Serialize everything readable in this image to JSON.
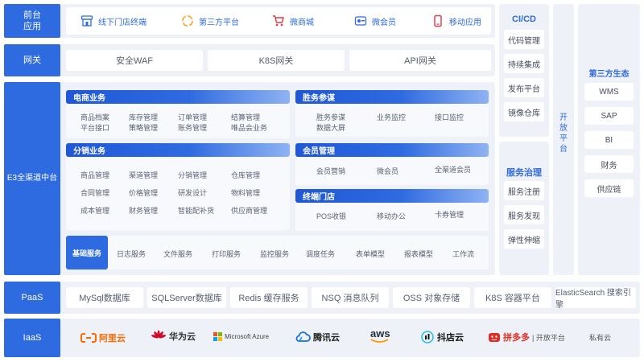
{
  "frontend": {
    "label": "前台\n应用",
    "items": [
      {
        "label": "线下门店终端",
        "icon": "store-icon"
      },
      {
        "label": "第三方平台",
        "icon": "cycle-icon"
      },
      {
        "label": "微商城",
        "icon": "cart-icon"
      },
      {
        "label": "微会员",
        "icon": "member-icon"
      },
      {
        "label": "移动应用",
        "icon": "phone-icon"
      }
    ]
  },
  "gateway": {
    "label": "网关",
    "items": [
      "安全WAF",
      "K8S网关",
      "API网关"
    ]
  },
  "middle": {
    "label": "E3全渠道中台",
    "ecommerce": {
      "title": "电商业务",
      "row1": [
        "商品档案",
        "库存管理",
        "订单管理",
        "结算管理"
      ],
      "row2": [
        "平台接口",
        "策略管理",
        "账务管理",
        "唯品会业务"
      ]
    },
    "distribution": {
      "title": "分销业务",
      "rows": [
        [
          "商品管理",
          "渠道管理",
          "分销管理",
          "仓库管理"
        ],
        [
          "合同管理",
          "价格管理",
          "研发设计",
          "物料管理"
        ],
        [
          "成本管理",
          "财务管理",
          "智能配补货",
          "供应商管理"
        ]
      ]
    },
    "legal": {
      "title": "胜务参谋",
      "row1": [
        "胜务参谋",
        "业务监控",
        "接口监控"
      ],
      "row2": [
        "数据大屏"
      ]
    },
    "member": {
      "title": "会员管理",
      "items": [
        "会员营销",
        "微会员",
        "全渠道会员"
      ]
    },
    "store": {
      "title": "终端门店",
      "items": [
        "POS收银",
        "移动办公",
        "卡券管理"
      ]
    },
    "basic": {
      "title": "基础服务",
      "items": [
        "日志服务",
        "文件服务",
        "打印服务",
        "监控服务",
        "调度任务",
        "表单模型",
        "报表模型",
        "工作流"
      ]
    }
  },
  "cicd": {
    "title": "CI/CD",
    "items": [
      "代码管理",
      "持续集成",
      "发布平台",
      "镜像仓库"
    ]
  },
  "governance": {
    "title": "服务治理",
    "items": [
      "服务注册",
      "服务发现",
      "弹性伸缩"
    ]
  },
  "open_platform": {
    "label": "开\n放\n平\n台"
  },
  "third_party": {
    "title": "第三方生态",
    "items": [
      "WMS",
      "SAP",
      "BI",
      "财务",
      "供应链"
    ]
  },
  "paas": {
    "label": "PaaS",
    "items": [
      "MySql数据库",
      "SQLServer数据库",
      "Redis 缓存服务",
      "NSQ 消息队列",
      "OSS 对象存储",
      "K8S 容器平台",
      "ElasticSearch 搜索引擎"
    ]
  },
  "iaas": {
    "label": "IaaS",
    "items": [
      {
        "label": "阿里云",
        "icon": "aliyun-logo",
        "color": "#ff6a00"
      },
      {
        "label": "华为云",
        "icon": "huawei-logo",
        "color": "#cf0a2c"
      },
      {
        "label": "Microsoft Azure",
        "icon": "microsoft-logo",
        "color": "#444444"
      },
      {
        "label": "腾讯云",
        "icon": "tencent-cloud-logo",
        "color": "#1a6fd6"
      },
      {
        "label": "aws",
        "icon": "aws-logo",
        "color": "#232f3e"
      },
      {
        "label": "抖店云",
        "icon": "douyin-logo",
        "color": "#111111"
      },
      {
        "label": "拼多多",
        "icon": "pinduoduo-logo",
        "color": "#e02e24"
      },
      {
        "label": "| 开放平台",
        "icon": "",
        "color": "#555555"
      },
      {
        "label": "私有云",
        "icon": "",
        "color": "#555555"
      }
    ]
  },
  "colors": {
    "accent": "#2f6be0",
    "band": "#eef1f7",
    "panel": "#f8f9fc"
  }
}
